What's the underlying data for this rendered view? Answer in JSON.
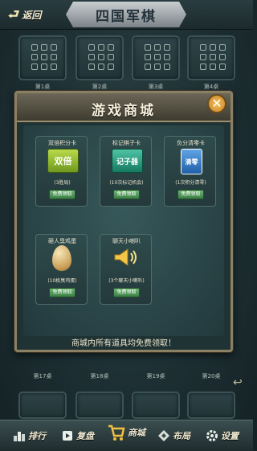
{
  "header": {
    "back_label": "返回",
    "game_title": "四国军棋"
  },
  "tables": {
    "top_labels": [
      "第1桌",
      "第2桌",
      "第3桌",
      "第4桌"
    ],
    "bottom_labels": [
      "第17桌",
      "第18桌",
      "第19桌",
      "第20桌"
    ]
  },
  "modal": {
    "title": "游戏商城",
    "notice": "商城内所有道具均免费领取！",
    "items": [
      {
        "name": "双倍积分卡",
        "icon_text": "双倍",
        "desc": "(3胜局)",
        "button": "免费领取",
        "icon": "double-points-icon"
      },
      {
        "name": "标记棋子卡",
        "icon_text": "记子器",
        "desc": "(10次标记机会)",
        "button": "免费领取",
        "icon": "piece-marker-icon"
      },
      {
        "name": "负分清零卡",
        "icon_text": "清零",
        "desc": "(1次积分清零)",
        "button": "免费领取",
        "icon": "clear-score-icon"
      },
      {
        "name": "砸人臭鸡蛋",
        "icon_text": "",
        "desc": "(10枚臭鸡蛋)",
        "button": "免费领取",
        "icon": "egg-icon"
      },
      {
        "name": "聊天小喇叭",
        "icon_text": "",
        "desc": "(3个聊天小喇叭)",
        "button": "免费领取",
        "icon": "speaker-icon"
      }
    ]
  },
  "bottom_nav": [
    {
      "label": "排行",
      "icon": "leaderboard-icon"
    },
    {
      "label": "复盘",
      "icon": "replay-icon"
    },
    {
      "label": "商城",
      "icon": "shop-cart-icon"
    },
    {
      "label": "布局",
      "icon": "layout-icon"
    },
    {
      "label": "设置",
      "icon": "gear-icon"
    }
  ]
}
